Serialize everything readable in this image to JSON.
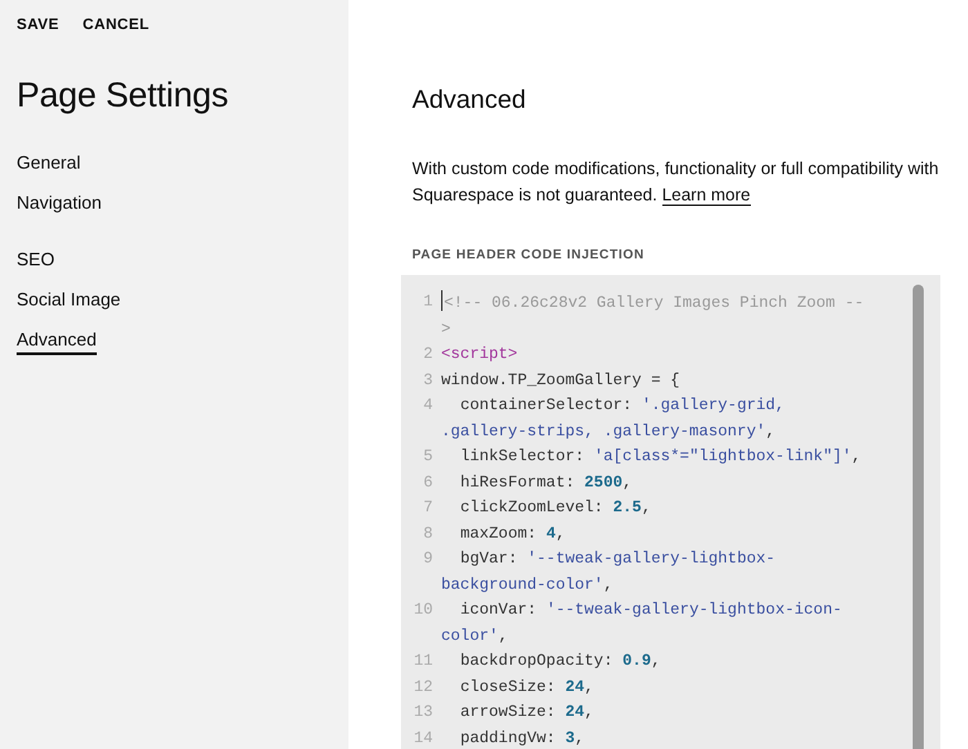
{
  "actions": [
    {
      "label": "SAVE"
    },
    {
      "label": "CANCEL"
    }
  ],
  "sidebar": {
    "title": "Page Settings",
    "groups": [
      [
        {
          "label": "General",
          "selected": false
        },
        {
          "label": "Navigation",
          "selected": false
        }
      ],
      [
        {
          "label": "SEO",
          "selected": false
        },
        {
          "label": "Social Image",
          "selected": false
        },
        {
          "label": "Advanced",
          "selected": true
        }
      ]
    ]
  },
  "main": {
    "title": "Advanced",
    "description": "With custom code modifications, functionality or full compatibility with Squarespace is not guaranteed.",
    "link": "Learn more",
    "section_label": "PAGE HEADER CODE INJECTION",
    "code": [
      {
        "number": "1",
        "tokens": [
          {
            "kind": "comment",
            "text": "<!-- 06.26c28v2 Gallery Images Pinch Zoom -->"
          }
        ]
      },
      {
        "number": "2",
        "tokens": [
          {
            "kind": "tag",
            "text": "<script>"
          }
        ]
      },
      {
        "number": "3",
        "tokens": [
          {
            "kind": "plain",
            "text": "window.TP_ZoomGallery = {"
          }
        ]
      },
      {
        "number": "4",
        "tokens": [
          {
            "kind": "plain",
            "text": "  containerSelector: "
          },
          {
            "kind": "string",
            "text": "'.gallery-grid, .gallery-strips, .gallery-masonry'"
          },
          {
            "kind": "plain",
            "text": ","
          }
        ]
      },
      {
        "number": "5",
        "tokens": [
          {
            "kind": "plain",
            "text": "  linkSelector: "
          },
          {
            "kind": "string",
            "text": "'a[class*=\"lightbox-link\"]'"
          },
          {
            "kind": "plain",
            "text": ","
          }
        ]
      },
      {
        "number": "6",
        "tokens": [
          {
            "kind": "plain",
            "text": "  hiResFormat: "
          },
          {
            "kind": "number",
            "text": "2500"
          },
          {
            "kind": "plain",
            "text": ","
          }
        ]
      },
      {
        "number": "7",
        "tokens": [
          {
            "kind": "plain",
            "text": "  clickZoomLevel: "
          },
          {
            "kind": "number",
            "text": "2.5"
          },
          {
            "kind": "plain",
            "text": ","
          }
        ]
      },
      {
        "number": "8",
        "tokens": [
          {
            "kind": "plain",
            "text": "  maxZoom: "
          },
          {
            "kind": "number",
            "text": "4"
          },
          {
            "kind": "plain",
            "text": ","
          }
        ]
      },
      {
        "number": "9",
        "tokens": [
          {
            "kind": "plain",
            "text": "  bgVar: "
          },
          {
            "kind": "string",
            "text": "'--tweak-gallery-lightbox-background-color'"
          },
          {
            "kind": "plain",
            "text": ","
          }
        ]
      },
      {
        "number": "10",
        "tokens": [
          {
            "kind": "plain",
            "text": "  iconVar: "
          },
          {
            "kind": "string",
            "text": "'--tweak-gallery-lightbox-icon-color'"
          },
          {
            "kind": "plain",
            "text": ","
          }
        ]
      },
      {
        "number": "11",
        "tokens": [
          {
            "kind": "plain",
            "text": "  backdropOpacity: "
          },
          {
            "kind": "number",
            "text": "0.9"
          },
          {
            "kind": "plain",
            "text": ","
          }
        ]
      },
      {
        "number": "12",
        "tokens": [
          {
            "kind": "plain",
            "text": "  closeSize: "
          },
          {
            "kind": "number",
            "text": "24"
          },
          {
            "kind": "plain",
            "text": ","
          }
        ]
      },
      {
        "number": "13",
        "tokens": [
          {
            "kind": "plain",
            "text": "  arrowSize: "
          },
          {
            "kind": "number",
            "text": "24"
          },
          {
            "kind": "plain",
            "text": ","
          }
        ]
      },
      {
        "number": "14",
        "tokens": [
          {
            "kind": "plain",
            "text": "  paddingVw: "
          },
          {
            "kind": "number",
            "text": "3"
          },
          {
            "kind": "plain",
            "text": ","
          }
        ]
      }
    ]
  }
}
